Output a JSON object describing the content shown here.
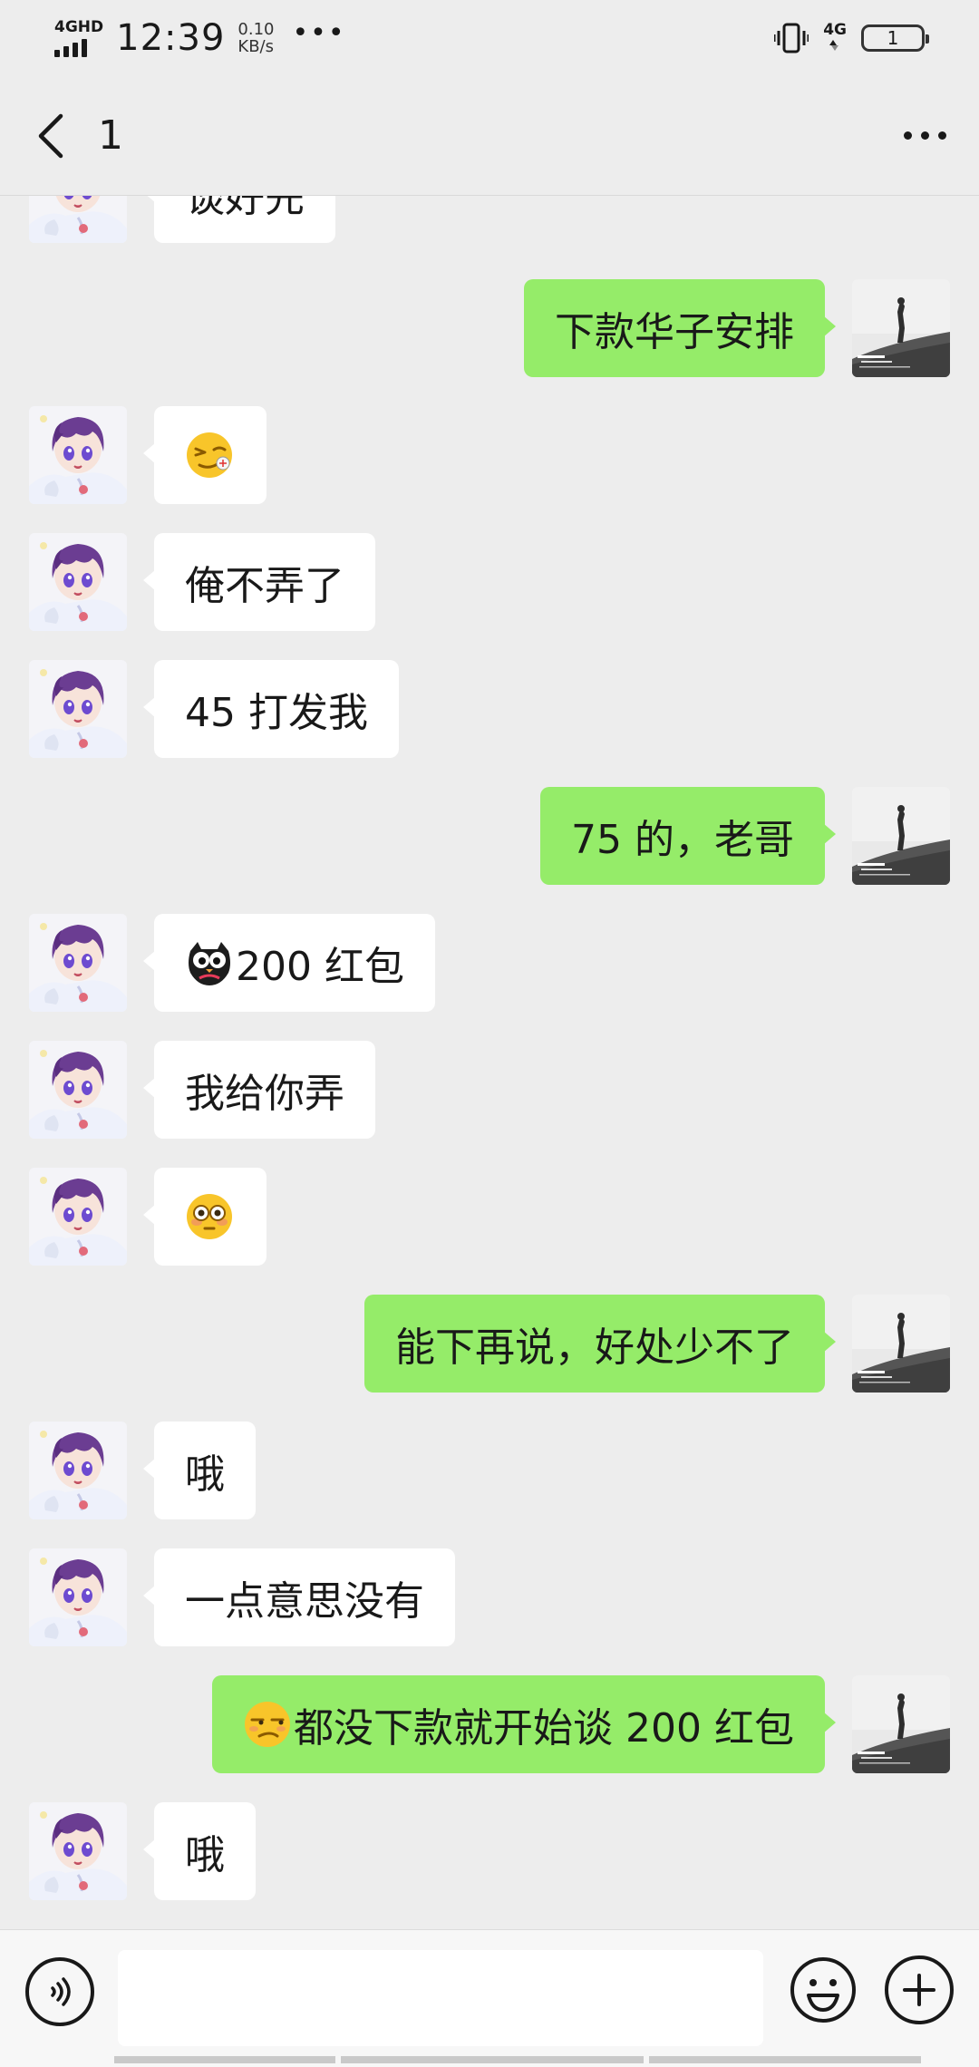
{
  "status_bar": {
    "network_label": "4GHD",
    "time": "12:39",
    "speed_value": "0.10",
    "speed_unit": "KB/s",
    "more_dots": "•••",
    "net_right": "4G",
    "battery": "1"
  },
  "nav": {
    "title": "1"
  },
  "messages": [
    {
      "side": "left",
      "text": "谈好先"
    },
    {
      "side": "right",
      "text": "下款华子安排"
    },
    {
      "side": "left",
      "emoji": "smirk-wink-emoji",
      "text": ""
    },
    {
      "side": "left",
      "text": "俺不弄了"
    },
    {
      "side": "left",
      "text": "45 打发我"
    },
    {
      "side": "right",
      "text": "75 的，老哥"
    },
    {
      "side": "left",
      "emoji": "owl-emoji",
      "text": "200 红包"
    },
    {
      "side": "left",
      "text": "我给你弄"
    },
    {
      "side": "left",
      "emoji": "flushed-emoji",
      "text": ""
    },
    {
      "side": "right",
      "text": "能下再说，好处少不了"
    },
    {
      "side": "left",
      "text": "哦"
    },
    {
      "side": "left",
      "text": "一点意思没有"
    },
    {
      "side": "right",
      "emoji": "unamused-emoji",
      "text": "都没下款就开始谈 200 红包"
    },
    {
      "side": "left",
      "text": "哦"
    }
  ],
  "input_bar": {
    "placeholder": "",
    "voice_icon": "voice-icon",
    "emoji_icon": "emoji-icon",
    "plus_icon": "plus-icon"
  },
  "colors": {
    "background": "#ededed",
    "bubble_self": "#95ec69",
    "bubble_other": "#ffffff",
    "text": "#191919"
  }
}
